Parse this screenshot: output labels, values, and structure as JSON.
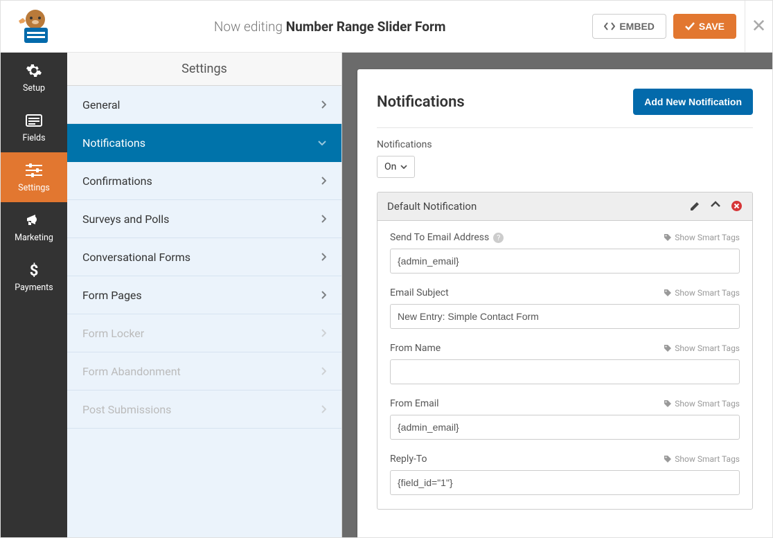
{
  "header": {
    "editing_prefix": "Now editing ",
    "form_name": "Number Range Slider Form",
    "embed": "EMBED",
    "save": "SAVE"
  },
  "rail": [
    {
      "id": "setup",
      "label": "Setup"
    },
    {
      "id": "fields",
      "label": "Fields"
    },
    {
      "id": "settings",
      "label": "Settings"
    },
    {
      "id": "marketing",
      "label": "Marketing"
    },
    {
      "id": "payments",
      "label": "Payments"
    }
  ],
  "settings_title": "Settings",
  "menu": [
    {
      "label": "General",
      "state": "normal"
    },
    {
      "label": "Notifications",
      "state": "active"
    },
    {
      "label": "Confirmations",
      "state": "normal"
    },
    {
      "label": "Surveys and Polls",
      "state": "normal"
    },
    {
      "label": "Conversational Forms",
      "state": "normal"
    },
    {
      "label": "Form Pages",
      "state": "normal"
    },
    {
      "label": "Form Locker",
      "state": "disabled"
    },
    {
      "label": "Form Abandonment",
      "state": "disabled"
    },
    {
      "label": "Post Submissions",
      "state": "disabled"
    }
  ],
  "panel": {
    "title": "Notifications",
    "add_button": "Add New Notification",
    "toggle_label": "Notifications",
    "toggle_value": "On",
    "card_title": "Default Notification",
    "smart_tags": "Show Smart Tags",
    "fields": {
      "send_to": {
        "label": "Send To Email Address",
        "value": "{admin_email}",
        "help": true
      },
      "subject": {
        "label": "Email Subject",
        "value": "New Entry: Simple Contact Form"
      },
      "from_name": {
        "label": "From Name",
        "value": ""
      },
      "from_email": {
        "label": "From Email",
        "value": "{admin_email}"
      },
      "reply_to": {
        "label": "Reply-To",
        "value": "{field_id=\"1\"}"
      }
    }
  }
}
